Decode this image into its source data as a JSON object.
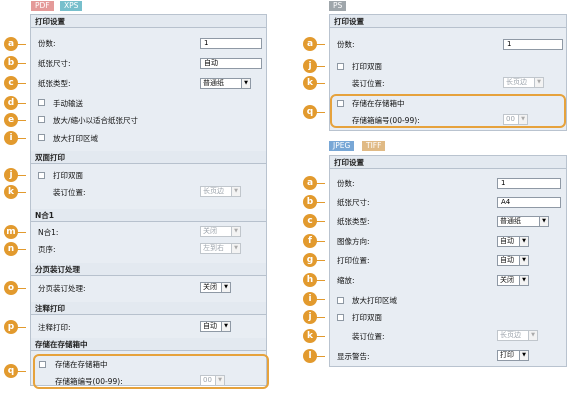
{
  "tags": {
    "pdf": "PDF",
    "xps": "XPS",
    "ps": "PS",
    "jpeg": "JPEG",
    "tiff": "TIFF"
  },
  "left": {
    "print_settings": "打印设置",
    "copies_label": "份数:",
    "copies_value": "1",
    "paper_size_label": "纸张尺寸:",
    "paper_size_value": "自动",
    "paper_type_label": "纸张类型:",
    "paper_type_value": "普通纸",
    "manual_feed_label": "手动输送",
    "fit_label": "放大/缩小以适合纸张尺寸",
    "enlarge_label": "放大打印区域",
    "duplex_head": "双面打印",
    "duplex_label": "打印双面",
    "binding_label": "装订位置:",
    "binding_value": "长页边",
    "nup_head": "N合1",
    "nup_label": "N合1:",
    "nup_value": "关闭",
    "order_label": "页序:",
    "order_value": "左到右",
    "collate_head": "分页装订处理",
    "collate_label": "分页装订处理:",
    "collate_value": "关闭",
    "annot_head": "注释打印",
    "annot_label": "注释打印:",
    "annot_value": "自动",
    "box_head": "存储在存储箱中",
    "box_label": "存储在存储箱中",
    "boxno_label": "存储箱编号(00-99):",
    "boxno_value": "00"
  },
  "ps": {
    "print_settings": "打印设置",
    "copies_label": "份数:",
    "copies_value": "1",
    "duplex_label": "打印双面",
    "binding_label": "装订位置:",
    "binding_value": "长页边",
    "box_label": "存储在存储箱中",
    "boxno_label": "存储箱编号(00-99):",
    "boxno_value": "00"
  },
  "jpeg": {
    "print_settings": "打印设置",
    "copies_label": "份数:",
    "copies_value": "1",
    "paper_size_label": "纸张尺寸:",
    "paper_size_value": "A4",
    "paper_type_label": "纸张类型:",
    "paper_type_value": "普通纸",
    "orient_label": "图像方向:",
    "orient_value": "自动",
    "pos_label": "打印位置:",
    "pos_value": "自动",
    "zoom_label": "缩放:",
    "zoom_value": "关闭",
    "enlarge_label": "放大打印区域",
    "duplex_label": "打印双面",
    "binding_label": "装订位置:",
    "binding_value": "长页边",
    "warn_label": "显示警告:",
    "warn_value": "打印"
  },
  "badges": {
    "a": "a",
    "b": "b",
    "c": "c",
    "d": "d",
    "e": "e",
    "f": "f",
    "g": "g",
    "h": "h",
    "i": "i",
    "j": "j",
    "k": "k",
    "l": "l",
    "m": "m",
    "n": "n",
    "o": "o",
    "p": "p",
    "q": "q"
  },
  "colors": {
    "pdf": "#e49a99",
    "xps": "#77bfcc",
    "ps": "#9fa6ab",
    "jpeg": "#78a7d6",
    "tiff": "#e0ba85",
    "badge": "#e29a2e"
  }
}
